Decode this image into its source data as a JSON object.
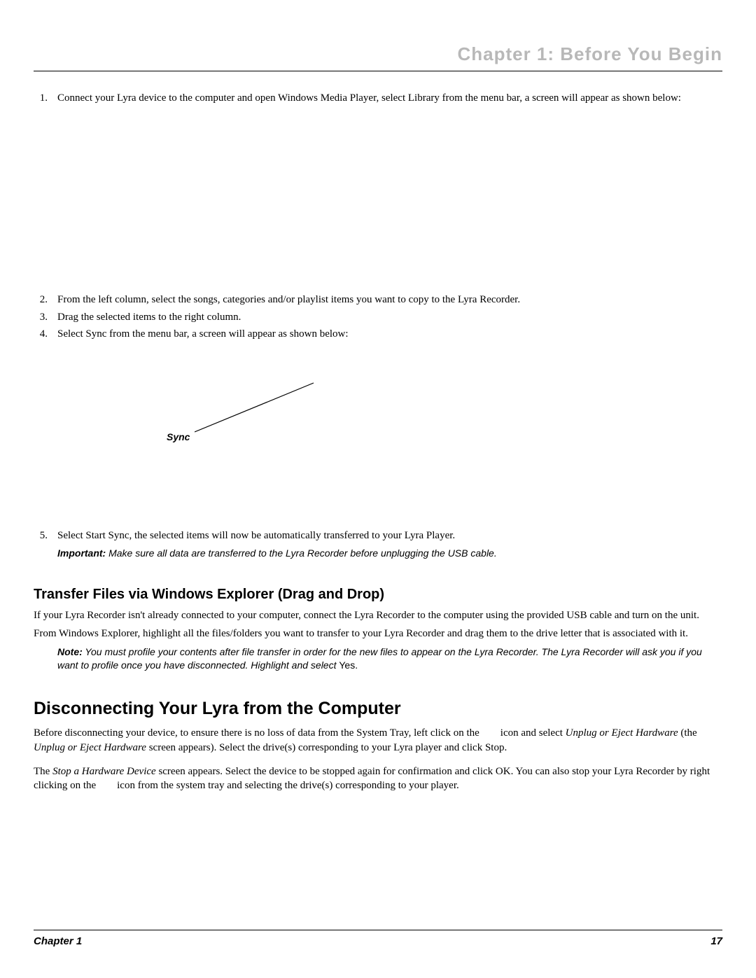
{
  "chapter_header": "Chapter 1: Before You Begin",
  "steps_a": [
    {
      "n": "1.",
      "t": "Connect your Lyra device to the computer and open Windows Media Player, select Library from the menu bar, a screen will appear as shown below:"
    }
  ],
  "steps_b": [
    {
      "n": "2.",
      "t": "From the left column, select the songs, categories and/or playlist items you want to copy to the Lyra Recorder."
    },
    {
      "n": "3.",
      "t": "Drag the selected items to the right column."
    },
    {
      "n": "4.",
      "t": "Select Sync from the menu bar, a screen will appear as shown below:"
    }
  ],
  "sync_label": "Sync",
  "steps_c": [
    {
      "n": "5.",
      "t": "Select Start Sync, the selected items will now be automatically transferred to your Lyra Player."
    }
  ],
  "important_label": "Important:",
  "important_text": " Make sure all data are transferred to the Lyra Recorder before unplugging the USB cable.",
  "h2": "Transfer Files via Windows Explorer (Drag and Drop)",
  "p1": "If your Lyra Recorder isn't already connected to your computer, connect the Lyra Recorder to the computer using the provided USB cable and turn on the unit.",
  "p2": "From Windows Explorer, highlight all the files/folders you want to transfer to your Lyra Recorder and drag them to the drive letter that is associated with it.",
  "note_label": "Note:",
  "note_text_1": " You must profile your contents after file transfer in order for the new files to appear on the Lyra Recorder. The Lyra Recorder will ask you if you want to profile once you have disconnected. Highlight and select ",
  "note_yes": "Yes.",
  "h1": "Disconnecting Your Lyra from the Computer",
  "p3_a": "Before disconnecting your device, to ensure there is no loss of data from the System Tray, left click on the        icon and select ",
  "p3_i1": "Unplug or Eject Hardware",
  "p3_b": " (the ",
  "p3_i2": "Unplug or Eject Hardware",
  "p3_c": " screen appears). Select the drive(s) corresponding to your Lyra player and click Stop.",
  "p4_a": "The ",
  "p4_i1": "Stop a Hardware Device",
  "p4_b": " screen appears. Select the device to be stopped again for confirmation and click OK. You can also stop your Lyra Recorder by right clicking on the        icon from the system tray and selecting the drive(s) corresponding to your player.",
  "footer_left": "Chapter 1",
  "footer_right": "17"
}
